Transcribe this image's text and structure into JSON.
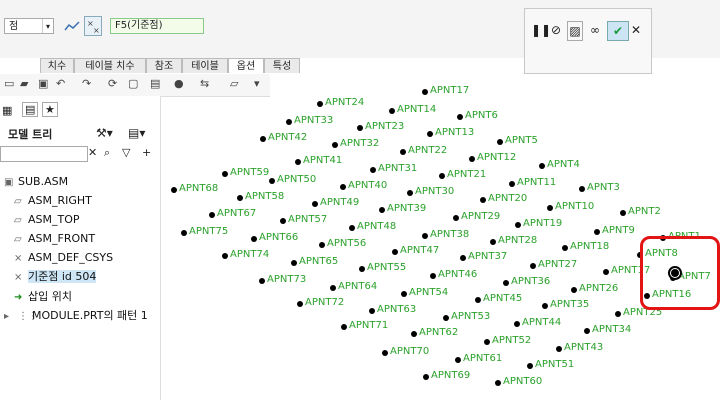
{
  "toolbar": {
    "type_select": "점",
    "name_field": "F5(기준점)",
    "ok_title": "",
    "tabs": [
      "치수",
      "테이블 치수",
      "참조",
      "테이블",
      "옵션",
      "특성"
    ]
  },
  "tree": {
    "tab_label": "모델 트리",
    "items": [
      {
        "label": "SUB.ASM",
        "icon": "assembly-icon"
      },
      {
        "label": "ASM_RIGHT",
        "icon": "datum-plane-icon"
      },
      {
        "label": "ASM_TOP",
        "icon": "datum-plane-icon"
      },
      {
        "label": "ASM_FRONT",
        "icon": "datum-plane-icon"
      },
      {
        "label": "ASM_DEF_CSYS",
        "icon": "csys-icon"
      },
      {
        "label": "기준점 id 504",
        "icon": "datum-point-icon"
      },
      {
        "label": "삽입 위치",
        "icon": "insert-arrow-icon"
      },
      {
        "label": "MODULE.PRT의 패턴 1",
        "icon": "pattern-icon"
      }
    ]
  },
  "points": [
    {
      "label": "APNT17"
    },
    {
      "label": "APNT24"
    },
    {
      "label": "APNT14"
    },
    {
      "label": "APNT6"
    },
    {
      "label": "APNT33"
    },
    {
      "label": "APNT23"
    },
    {
      "label": "APNT13"
    },
    {
      "label": "APNT42"
    },
    {
      "label": "APNT32"
    },
    {
      "label": "APNT5"
    },
    {
      "label": "APNT22"
    },
    {
      "label": "APNT12"
    },
    {
      "label": "APNT41"
    },
    {
      "label": "APNT4"
    },
    {
      "label": "APNT31"
    },
    {
      "label": "APNT59"
    },
    {
      "label": "APNT21"
    },
    {
      "label": "APNT50"
    },
    {
      "label": "APNT11"
    },
    {
      "label": "APNT40"
    },
    {
      "label": "APNT3"
    },
    {
      "label": "APNT68"
    },
    {
      "label": "APNT30"
    },
    {
      "label": "APNT58"
    },
    {
      "label": "APNT20"
    },
    {
      "label": "APNT49"
    },
    {
      "label": "APNT10"
    },
    {
      "label": "APNT39"
    },
    {
      "label": "APNT2"
    },
    {
      "label": "APNT67"
    },
    {
      "label": "APNT29"
    },
    {
      "label": "APNT57"
    },
    {
      "label": "APNT19"
    },
    {
      "label": "APNT48"
    },
    {
      "label": "APNT9"
    },
    {
      "label": "APNT75"
    },
    {
      "label": "APNT38"
    },
    {
      "label": "APNT1"
    },
    {
      "label": "APNT66"
    },
    {
      "label": "APNT28"
    },
    {
      "label": "APNT56"
    },
    {
      "label": "APNT18"
    },
    {
      "label": "APNT8"
    },
    {
      "label": "APNT47"
    },
    {
      "label": "APNT74"
    },
    {
      "label": "APNT37"
    },
    {
      "label": "APNT65"
    },
    {
      "label": "APNT27"
    },
    {
      "label": "APNT55"
    },
    {
      "label": "APNT17"
    },
    {
      "label": "APNT7"
    },
    {
      "label": "APNT46"
    },
    {
      "label": "APNT73"
    },
    {
      "label": "APNT36"
    },
    {
      "label": "APNT64"
    },
    {
      "label": "APNT26"
    },
    {
      "label": "APNT16"
    },
    {
      "label": "APNT54"
    },
    {
      "label": "APNT45"
    },
    {
      "label": "APNT72"
    },
    {
      "label": "APNT35"
    },
    {
      "label": "APNT25"
    },
    {
      "label": "APNT63"
    },
    {
      "label": "APNT44"
    },
    {
      "label": "APNT53"
    },
    {
      "label": "APNT71"
    },
    {
      "label": "APNT34"
    },
    {
      "label": "APNT62"
    },
    {
      "label": "APNT52"
    },
    {
      "label": "APNT43"
    },
    {
      "label": "APNT70"
    },
    {
      "label": "APNT61"
    },
    {
      "label": "APNT51"
    },
    {
      "label": "APNT69"
    },
    {
      "label": "APNT60"
    }
  ],
  "colors": {
    "label": "#2ba12b",
    "highlight": "#e21414",
    "selected": "#cfe6f7"
  }
}
